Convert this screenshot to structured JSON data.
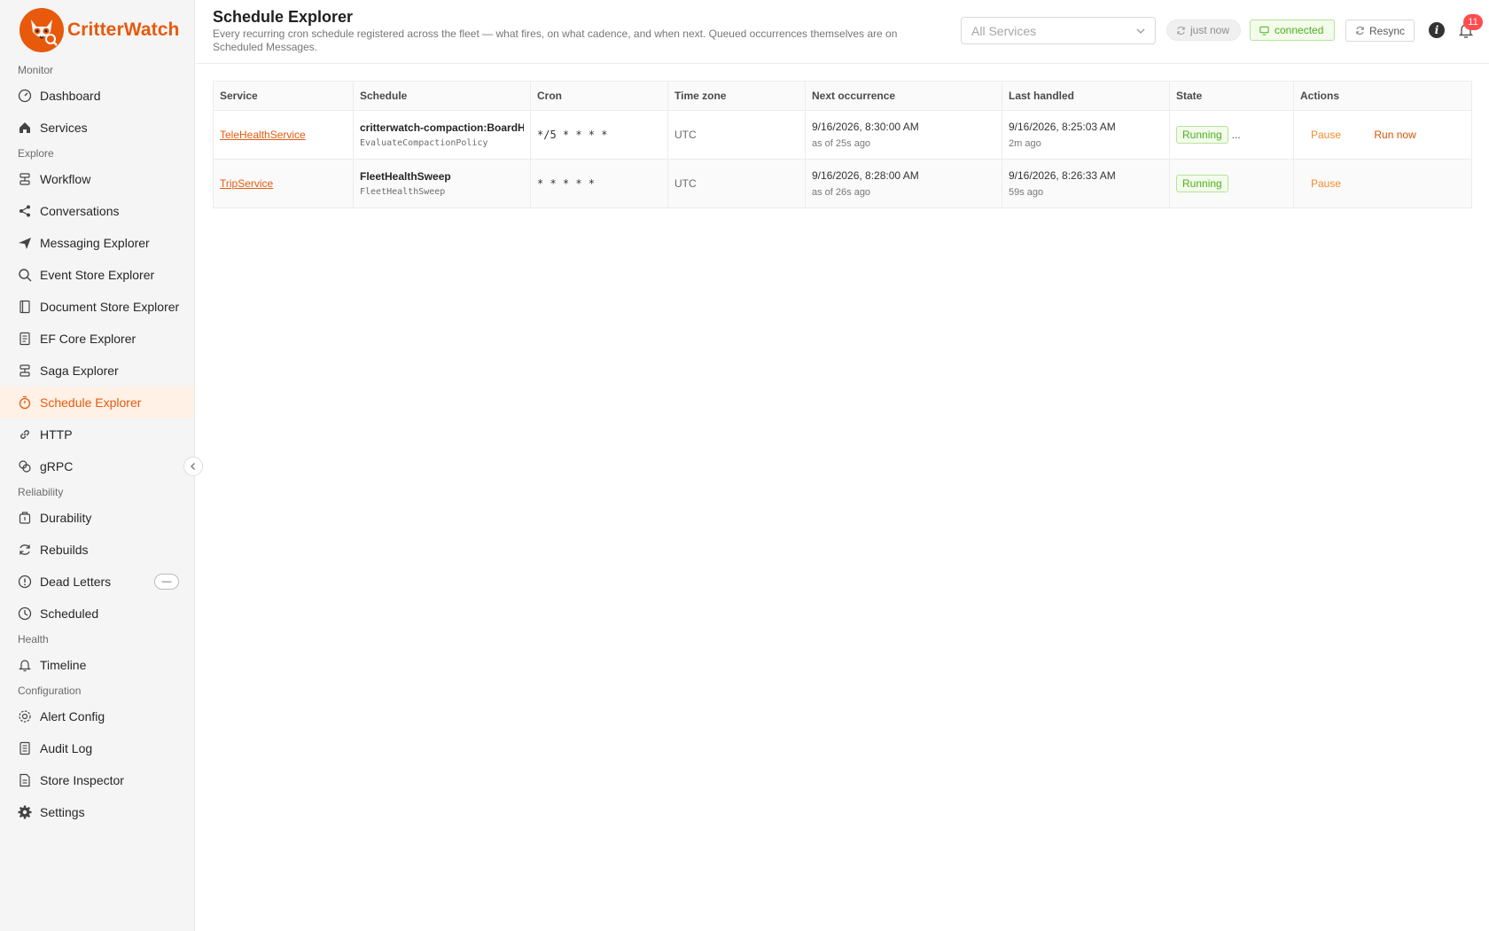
{
  "app": {
    "name": "CritterWatch"
  },
  "sidebar": {
    "sections": {
      "monitor": "Monitor",
      "explore": "Explore",
      "reliability": "Reliability",
      "health": "Health",
      "configuration": "Configuration"
    },
    "items": {
      "dashboard": "Dashboard",
      "services": "Services",
      "workflow": "Workflow",
      "conversations": "Conversations",
      "messaging": "Messaging Explorer",
      "eventstore": "Event Store Explorer",
      "docstore": "Document Store Explorer",
      "efcore": "EF Core Explorer",
      "saga": "Saga Explorer",
      "schedule": "Schedule Explorer",
      "http": "HTTP",
      "grpc": "gRPC",
      "durability": "Durability",
      "rebuilds": "Rebuilds",
      "deadletters": "Dead Letters",
      "scheduled": "Scheduled",
      "timeline": "Timeline",
      "alertconfig": "Alert Config",
      "auditlog": "Audit Log",
      "storeinspector": "Store Inspector",
      "settings": "Settings"
    },
    "active": "schedule"
  },
  "header": {
    "title": "Schedule Explorer",
    "description": "Every recurring cron schedule registered across the fleet — what fires, on what cadence, and when next. Queued occurrences themselves are on Scheduled Messages.",
    "service_filter": "All Services",
    "refresh_status": "just now",
    "connection_status": "connected",
    "resync_label": "Resync",
    "notification_count": "11"
  },
  "table": {
    "columns": [
      "Service",
      "Schedule",
      "Cron",
      "Time zone",
      "Next occurrence",
      "Last handled",
      "State",
      "Actions"
    ],
    "rows": [
      {
        "service": "TeleHealthService",
        "schedule_name": "critterwatch-compaction:BoardHi",
        "schedule_type": "EvaluateCompactionPolicy",
        "cron": "*/5 * * * *",
        "timezone": "UTC",
        "next": "9/16/2026, 8:30:00 AM",
        "next_rel": "as of 25s ago",
        "last": "9/16/2026, 8:25:03 AM",
        "last_rel": "2m ago",
        "state": "Running",
        "more": "...",
        "action_pause": "Pause",
        "action_run": "Run now"
      },
      {
        "service": "TripService",
        "schedule_name": "FleetHealthSweep",
        "schedule_type": "FleetHealthSweep",
        "cron": "* * * * *",
        "timezone": "UTC",
        "next": "9/16/2026, 8:28:00 AM",
        "next_rel": "as of 26s ago",
        "last": "9/16/2026, 8:26:33 AM",
        "last_rel": "59s ago",
        "state": "Running",
        "action_pause": "Pause"
      }
    ]
  },
  "colors": {
    "accent": "#e8590c",
    "success": "#4caf22",
    "danger": "#ff4d4f"
  }
}
